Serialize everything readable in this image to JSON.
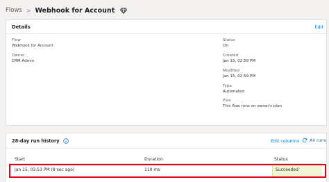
{
  "breadcrumb": {
    "parent": "Flows",
    "separator": ">",
    "current": "Webhook for Account"
  },
  "details": {
    "title": "Details",
    "edit_label": "Edit",
    "flow": {
      "label": "Flow",
      "value": "Webhook for Account"
    },
    "owner": {
      "label": "Owner",
      "value": "CRM Admin"
    },
    "status": {
      "label": "Status",
      "value": "On"
    },
    "created": {
      "label": "Created",
      "value": "Jan 15, 02:59 PM"
    },
    "modified": {
      "label": "Modified",
      "value": "Jan 15, 02:59 PM"
    },
    "type": {
      "label": "Type",
      "value": "Automated"
    },
    "plan": {
      "label": "Plan",
      "value": "This flow runs on owner's plan"
    }
  },
  "run_history": {
    "title": "28-day run history",
    "edit_columns_label": "Edit columns",
    "all_runs_label": "All runs",
    "columns": [
      "Start",
      "Duration",
      "Status"
    ],
    "rows": [
      {
        "start": "Jan 15, 03:53 PM (8 sec ago)",
        "duration": "110 ms",
        "status": "Succeeded"
      }
    ]
  },
  "colors": {
    "accent": "#0078d4",
    "highlight_border": "#e0001b",
    "succeeded_bg": "#f1f7d5"
  },
  "icons": {
    "title_icon": "diamond-icon",
    "info": "info-icon",
    "refresh": "refresh-icon"
  }
}
